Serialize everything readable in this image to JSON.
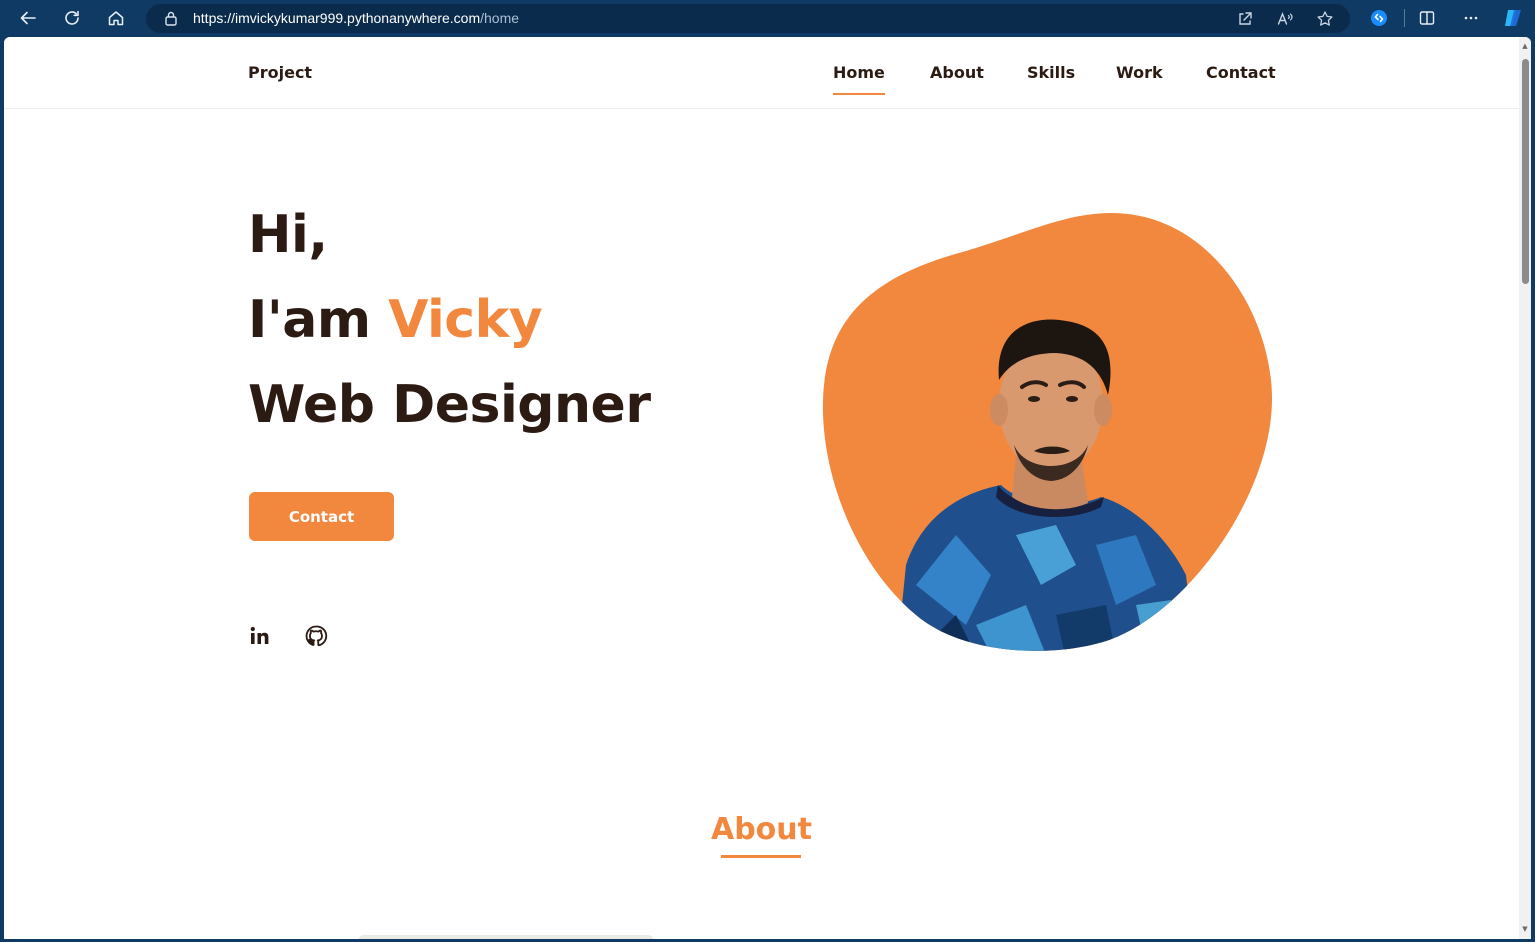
{
  "browser": {
    "url_host": "https://imvickykumar999.pythonanywhere.com",
    "url_path": "/home"
  },
  "header": {
    "logo": "Project",
    "nav": [
      {
        "label": "Home",
        "active": true
      },
      {
        "label": "About",
        "active": false
      },
      {
        "label": "Skills",
        "active": false
      },
      {
        "label": "Work",
        "active": false
      },
      {
        "label": "Contact",
        "active": false
      }
    ]
  },
  "hero": {
    "line1": "Hi,",
    "line2_prefix": "I'am",
    "line2_name": "Vicky",
    "line3": "Web Designer",
    "cta_label": "Contact",
    "social": [
      "linkedin-icon",
      "github-icon"
    ]
  },
  "about": {
    "title": "About"
  },
  "colors": {
    "accent": "#f2873e",
    "text": "#2b1b12",
    "browser_frame": "#0f3a63"
  }
}
